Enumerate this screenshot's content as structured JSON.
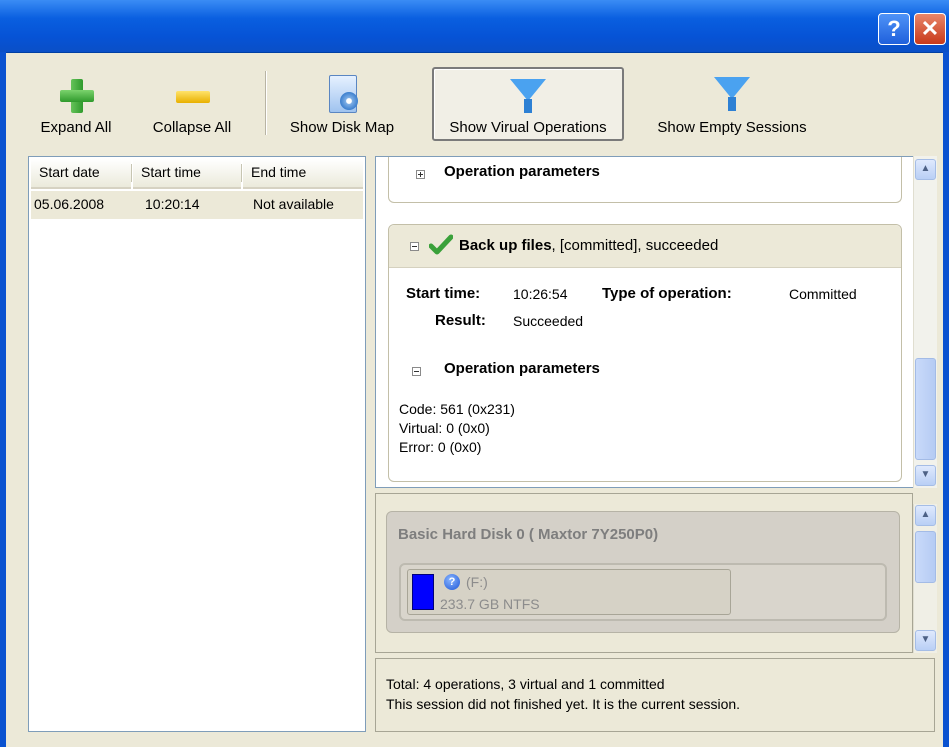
{
  "window": {
    "help_glyph": "?",
    "close_glyph": "✕"
  },
  "toolbar": {
    "items": [
      {
        "label": "Expand All",
        "icon": "plus-icon"
      },
      {
        "label": "Collapse All",
        "icon": "minus-icon"
      },
      {
        "label": "Show Disk Map",
        "icon": "disk-map-icon"
      },
      {
        "label": "Show Virual Operations",
        "icon": "funnel-icon",
        "pressed": true
      },
      {
        "label": "Show Empty Sessions",
        "icon": "funnel-icon"
      }
    ]
  },
  "sessions": {
    "columns": [
      "Start date",
      "Start time",
      "End time"
    ],
    "rows": [
      [
        "05.06.2008",
        "10:20:14",
        "Not available"
      ]
    ]
  },
  "details": {
    "top_group_title": "Operation parameters",
    "operation": {
      "name": "Back up files",
      "suffix": ", [committed], succeeded",
      "start_time_label": "Start time:",
      "start_time": "10:26:54",
      "type_label": "Type of operation:",
      "type": "Committed",
      "result_label": "Result:",
      "result": "Succeeded",
      "params_title": "Operation parameters",
      "params": [
        "Code: 561 (0x231)",
        "Virtual: 0 (0x0)",
        "Error: 0 (0x0)"
      ]
    }
  },
  "disk_map": {
    "disk_title": "Basic Hard Disk 0 ( Maxtor 7Y250P0)",
    "partition_label": "(F:)",
    "partition_size": "233.7 GB NTFS",
    "partition_color": "#0000ff"
  },
  "status": {
    "line1": "Total: 4 operations, 3 virtual and 1 committed",
    "line2": "This session did not finished yet. It is the current session."
  },
  "colors": {
    "titlebar": "#0653d6",
    "window_bg": "#ece9d8",
    "success_check": "#3aa13a"
  }
}
